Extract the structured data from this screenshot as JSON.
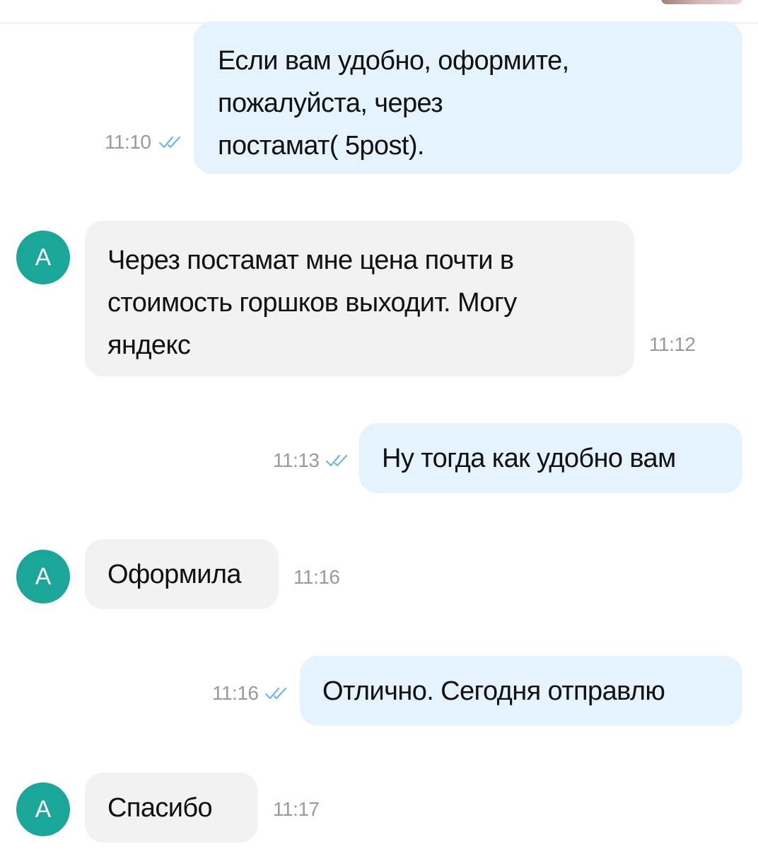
{
  "messages": [
    {
      "from": "me",
      "text": "Если вам удобно, оформите,\nпожалуйста, через\nпостамат( 5post).",
      "time": "11:10",
      "read": true
    },
    {
      "from": "contact",
      "text": "Через постамат мне цена почти в\nстоимость горшков выходит. Могу\nяндекс",
      "time": "11:12"
    },
    {
      "from": "me",
      "text": "Ну тогда как удобно вам",
      "time": "11:13",
      "read": true
    },
    {
      "from": "contact",
      "text": "Оформила",
      "time": "11:16"
    },
    {
      "from": "me",
      "text": "Отлично. Сегодня отправлю",
      "time": "11:16",
      "read": true
    },
    {
      "from": "contact",
      "text": "Спасибо",
      "time": "11:17"
    }
  ],
  "contact": {
    "avatar_letter": "А",
    "avatar_color": "#1ba69a"
  },
  "colors": {
    "outgoing_bubble": "#e4f3fd",
    "incoming_bubble": "#f2f2f2",
    "read_check": "#6fb8e6",
    "timestamp": "#9a9a9a"
  },
  "icons": {
    "read_receipt": "double-check-icon"
  }
}
